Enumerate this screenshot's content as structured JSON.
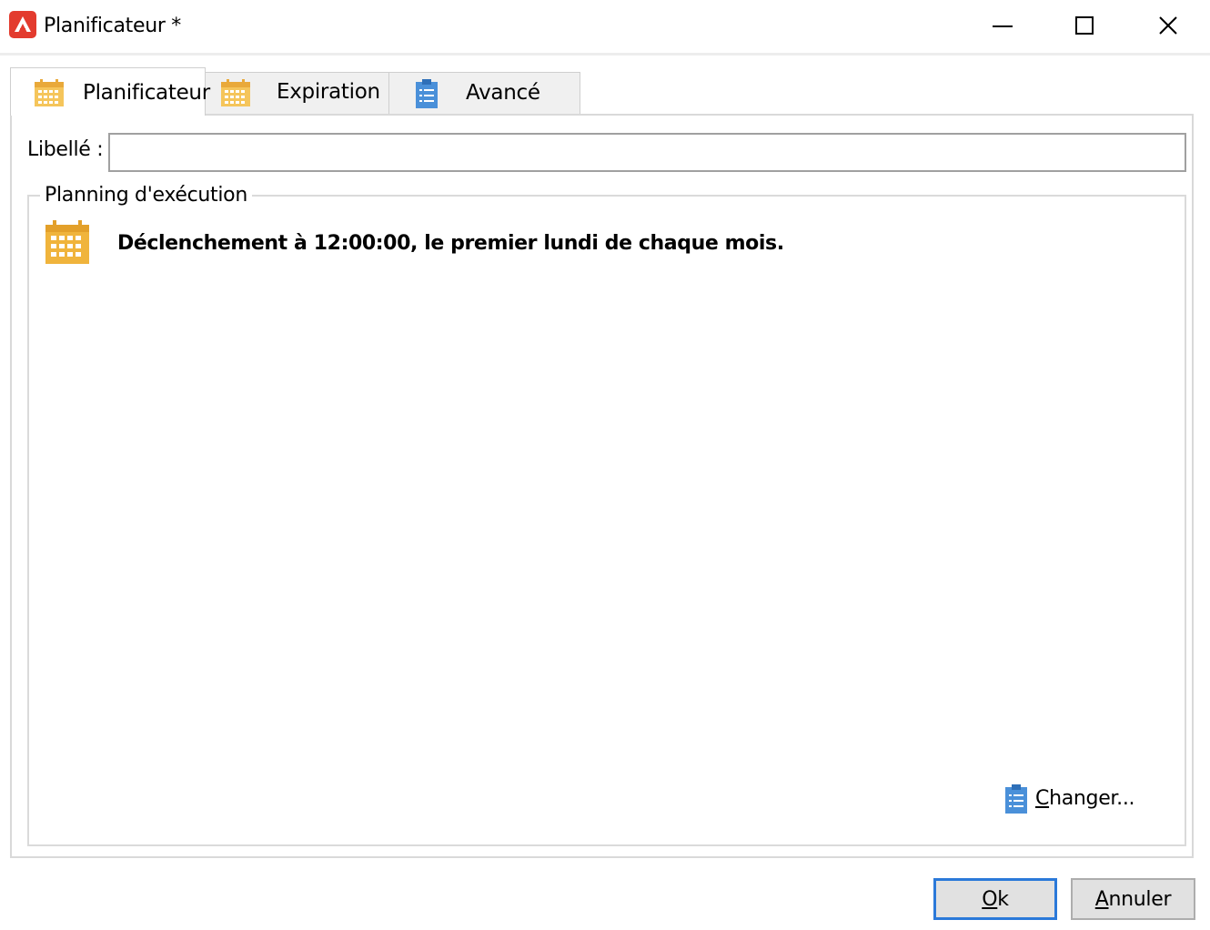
{
  "window": {
    "title": "Planificateur *",
    "controls": {
      "minimize": "minimize-icon",
      "maximize": "maximize-icon",
      "close": "close-icon"
    },
    "accent_color": "#e33b2e"
  },
  "tabs": [
    {
      "label": "Planificateur",
      "icon": "calendar-icon",
      "selected": true
    },
    {
      "label": "Expiration",
      "icon": "calendar-icon",
      "selected": false
    },
    {
      "label": "Avancé",
      "icon": "clipboard-icon",
      "selected": false
    }
  ],
  "form": {
    "libelle_label": "Libellé :",
    "libelle_value": ""
  },
  "schedule": {
    "group_title": "Planning d'exécution",
    "description": "Déclenchement à 12:00:00, le premier lundi de chaque mois.",
    "change_label": "Changer...",
    "icon_color": "#f0b43c"
  },
  "buttons": {
    "ok": "Ok",
    "cancel": "Annuler"
  }
}
